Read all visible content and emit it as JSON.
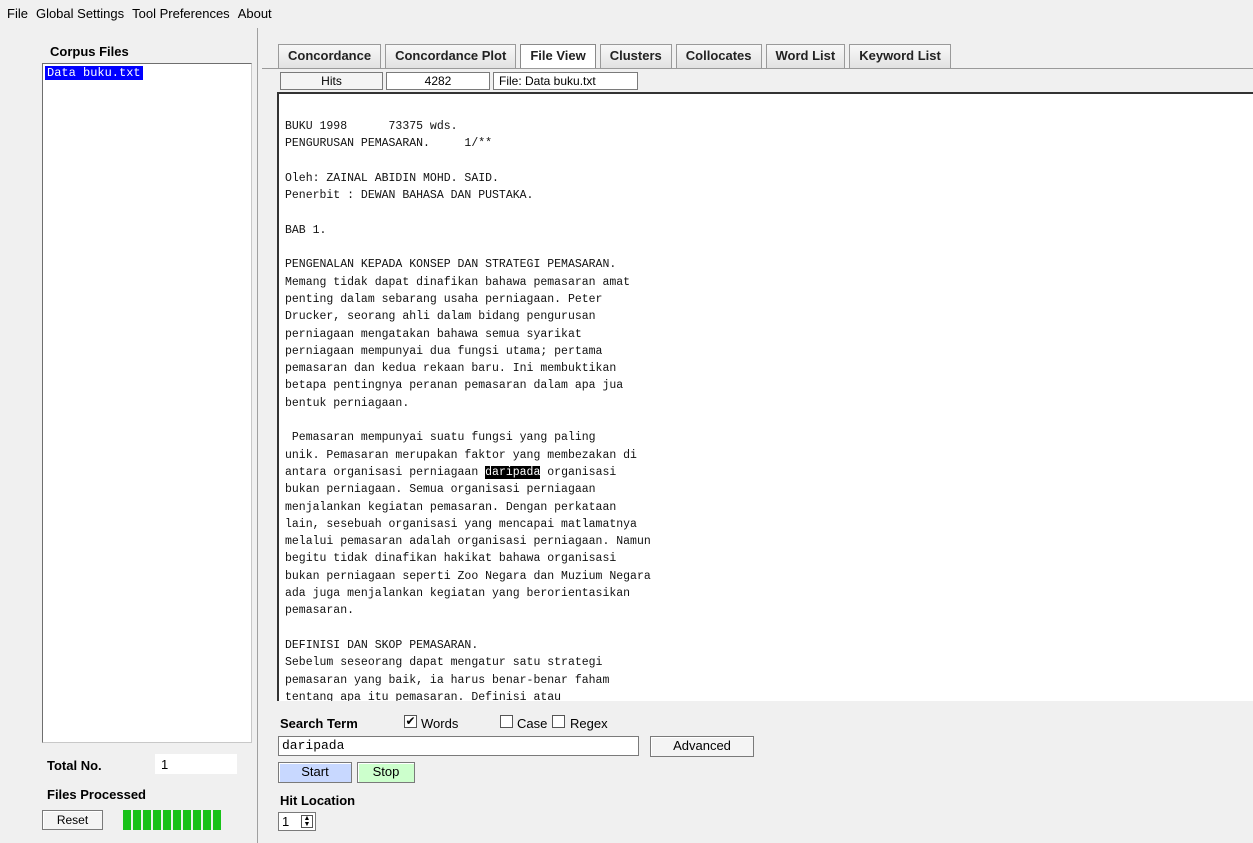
{
  "menu": [
    "File",
    "Global Settings",
    "Tool Preferences",
    "About"
  ],
  "left": {
    "corpus_title": "Corpus Files",
    "files": [
      "Data buku.txt"
    ],
    "total_label": "Total No.",
    "total_value": "1",
    "files_processed_label": "Files Processed",
    "reset_label": "Reset",
    "progress_segments": 10,
    "progress_color": "#19c219"
  },
  "tabs": [
    {
      "label": "Concordance",
      "active": false
    },
    {
      "label": "Concordance Plot",
      "active": false
    },
    {
      "label": "File View",
      "active": true
    },
    {
      "label": "Clusters",
      "active": false
    },
    {
      "label": "Collocates",
      "active": false
    },
    {
      "label": "Word List",
      "active": false
    },
    {
      "label": "Keyword List",
      "active": false
    }
  ],
  "infobar": {
    "hits_label": "Hits",
    "hits_value": "4282",
    "file_label": "File: Data buku.txt"
  },
  "textview": {
    "lines": [
      "BUKU 1998      73375 wds.",
      "PENGURUSAN PEMASARAN.     1/**",
      "",
      "Oleh: ZAINAL ABIDIN MOHD. SAID.",
      "Penerbit : DEWAN BAHASA DAN PUSTAKA.",
      "",
      "BAB 1.",
      "",
      "PENGENALAN KEPADA KONSEP DAN STRATEGI PEMASARAN.",
      "Memang tidak dapat dinafikan bahawa pemasaran amat",
      "penting dalam sebarang usaha perniagaan. Peter",
      "Drucker, seorang ahli dalam bidang pengurusan",
      "perniagaan mengatakan bahawa semua syarikat",
      "perniagaan mempunyai dua fungsi utama; pertama",
      "pemasaran dan kedua rekaan baru. Ini membuktikan",
      "betapa pentingnya peranan pemasaran dalam apa jua",
      "bentuk perniagaan.",
      "",
      " Pemasaran mempunyai suatu fungsi yang paling",
      "unik. Pemasaran merupakan faktor yang membezakan di",
      "antara organisasi perniagaan daripada organisasi",
      "bukan perniagaan. Semua organisasi perniagaan",
      "menjalankan kegiatan pemasaran. Dengan perkataan",
      "lain, sesebuah organisasi yang mencapai matlamatnya",
      "melalui pemasaran adalah organisasi perniagaan. Namun",
      "begitu tidak dinafikan hakikat bahawa organisasi",
      "bukan perniagaan seperti Zoo Negara dan Muzium Negara",
      "ada juga menjalankan kegiatan yang berorientasikan",
      "pemasaran.",
      "",
      "DEFINISI DAN SKOP PEMASARAN.",
      "Sebelum seseorang dapat mengatur satu strategi",
      "pemasaran yang baik, ia harus benar-benar faham",
      "tentang apa itu pemasaran. Definisi atau"
    ],
    "highlight_word": "daripada"
  },
  "search": {
    "label": "Search Term",
    "words_label": "Words",
    "words_checked": true,
    "case_label": "Case",
    "case_checked": false,
    "regex_label": "Regex",
    "regex_checked": false,
    "value": "daripada",
    "advanced_label": "Advanced",
    "start_label": "Start",
    "stop_label": "Stop"
  },
  "hit_location": {
    "label": "Hit Location",
    "value": "1"
  }
}
